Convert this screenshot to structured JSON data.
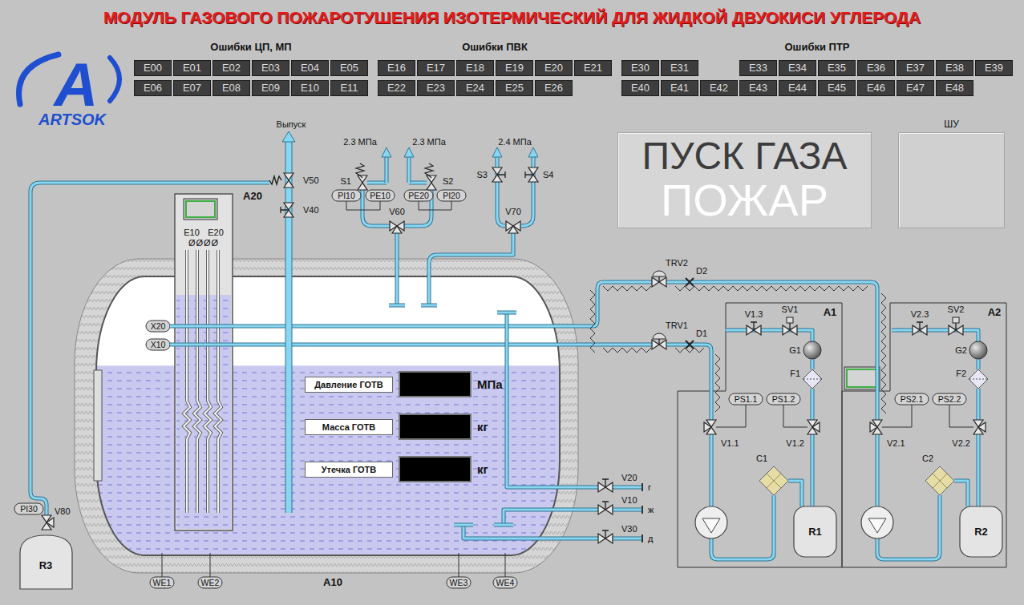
{
  "title": "МОДУЛЬ ГАЗОВОГО ПОЖАРОТУШЕНИЯ ИЗОТЕРМИЧЕСКИЙ ДЛЯ ЖИДКОЙ ДВУОКИСИ УГЛЕРОДА",
  "logo": {
    "letter": "A",
    "name": "ARTSOK"
  },
  "error_groups": [
    {
      "label": "Ошибки ЦП, МП",
      "rows": [
        [
          {
            "kind": "code",
            "code": "E00",
            "active": false
          },
          {
            "kind": "code",
            "code": "E01",
            "active": false
          },
          {
            "kind": "code",
            "code": "E02",
            "active": false
          },
          {
            "kind": "code",
            "code": "E03",
            "active": false
          },
          {
            "kind": "code",
            "code": "E04",
            "active": false
          },
          {
            "kind": "code",
            "code": "E05",
            "active": false
          }
        ],
        [
          {
            "kind": "code",
            "code": "E06",
            "active": false
          },
          {
            "kind": "code",
            "code": "E07",
            "active": false
          },
          {
            "kind": "code",
            "code": "E08",
            "active": false
          },
          {
            "kind": "code",
            "code": "E09",
            "active": false
          },
          {
            "kind": "code",
            "code": "E10",
            "active": false
          },
          {
            "kind": "code",
            "code": "E11",
            "active": false
          }
        ]
      ]
    },
    {
      "label": "Ошибки ПВК",
      "rows": [
        [
          {
            "kind": "code",
            "code": "E16",
            "active": false
          },
          {
            "kind": "code",
            "code": "E17",
            "active": false
          },
          {
            "kind": "code",
            "code": "E18",
            "active": false
          },
          {
            "kind": "code",
            "code": "E19",
            "active": false
          },
          {
            "kind": "code",
            "code": "E20",
            "active": false
          },
          {
            "kind": "code",
            "code": "E21",
            "active": false
          }
        ],
        [
          {
            "kind": "code",
            "code": "E22",
            "active": false
          },
          {
            "kind": "code",
            "code": "E23",
            "active": false
          },
          {
            "kind": "code",
            "code": "E24",
            "active": false
          },
          {
            "kind": "code",
            "code": "E25",
            "active": false
          },
          {
            "kind": "code",
            "code": "E26",
            "active": false
          }
        ]
      ]
    },
    {
      "label": "Ошибки ПТР",
      "rows": [
        [
          {
            "kind": "code",
            "code": "E30",
            "active": false
          },
          {
            "kind": "code",
            "code": "E31",
            "active": false
          },
          {
            "kind": "gap"
          },
          {
            "kind": "code",
            "code": "E33",
            "active": false
          },
          {
            "kind": "code",
            "code": "E34",
            "active": false
          },
          {
            "kind": "code",
            "code": "E35",
            "active": false
          },
          {
            "kind": "code",
            "code": "E36",
            "active": false
          },
          {
            "kind": "code",
            "code": "E37",
            "active": false
          },
          {
            "kind": "code",
            "code": "E38",
            "active": false
          },
          {
            "kind": "code",
            "code": "E39",
            "active": false
          }
        ],
        [
          {
            "kind": "code",
            "code": "E40",
            "active": false
          },
          {
            "kind": "code",
            "code": "E41",
            "active": false
          },
          {
            "kind": "code",
            "code": "E42",
            "active": false
          },
          {
            "kind": "code",
            "code": "E43",
            "active": false
          },
          {
            "kind": "code",
            "code": "E44",
            "active": false
          },
          {
            "kind": "code",
            "code": "E45",
            "active": false
          },
          {
            "kind": "code",
            "code": "E46",
            "active": false
          },
          {
            "kind": "code",
            "code": "E47",
            "active": false
          },
          {
            "kind": "code",
            "code": "E48",
            "active": false
          }
        ]
      ]
    }
  ],
  "outlet": {
    "label": "Выпуск",
    "pipe": "A20"
  },
  "tank": {
    "name": "A10",
    "level": 0.68,
    "lines": [
      "X20",
      "X10"
    ],
    "readouts": [
      {
        "label": "Давление ГОТВ",
        "unit": "МПа"
      },
      {
        "label": "Масса ГОТВ",
        "unit": "кг"
      },
      {
        "label": "Утечка ГОТВ",
        "unit": "кг"
      }
    ]
  },
  "heater": {
    "elements": [
      "E10",
      "E20"
    ],
    "terminals": "ØØØØ"
  },
  "setpoints": [
    "2.3 МПа",
    "2.3 МПа",
    "2.4 МПа"
  ],
  "valves": [
    {
      "tag": "V50",
      "kind": "relief"
    },
    {
      "tag": "V40",
      "kind": "gate"
    },
    {
      "tag": "V80",
      "kind": "three-way"
    },
    {
      "tag": "S1",
      "kind": "safety"
    },
    {
      "tag": "S2",
      "kind": "safety"
    },
    {
      "tag": "V60",
      "kind": "three-way"
    },
    {
      "tag": "S3",
      "kind": "gate"
    },
    {
      "tag": "S4",
      "kind": "gate"
    },
    {
      "tag": "V70",
      "kind": "three-way"
    },
    {
      "tag": "V20",
      "kind": "gate"
    },
    {
      "tag": "V10",
      "kind": "gate"
    },
    {
      "tag": "V30",
      "kind": "gate"
    },
    {
      "tag": "TRV2",
      "kind": "regulator"
    },
    {
      "tag": "TRV1",
      "kind": "regulator"
    },
    {
      "tag": "V1.3",
      "kind": "gate"
    },
    {
      "tag": "SV1",
      "kind": "solenoid"
    },
    {
      "tag": "V1.1",
      "kind": "three-way"
    },
    {
      "tag": "V1.2",
      "kind": "three-way"
    },
    {
      "tag": "V2.3",
      "kind": "gate"
    },
    {
      "tag": "SV2",
      "kind": "solenoid"
    },
    {
      "tag": "V2.1",
      "kind": "three-way"
    },
    {
      "tag": "V2.2",
      "kind": "three-way"
    }
  ],
  "instruments": [
    "PI10",
    "PE10",
    "PE20",
    "PI20",
    "PI30",
    "PS1.1",
    "PS1.2",
    "PS2.1",
    "PS2.2",
    "WE1",
    "WE2",
    "WE3",
    "WE4"
  ],
  "drains": [
    "г",
    "ж",
    "д"
  ],
  "orifices": [
    "D2",
    "D1"
  ],
  "equipment": [
    {
      "tag": "G1",
      "kind": "bottle"
    },
    {
      "tag": "F1",
      "kind": "filter"
    },
    {
      "tag": "C1",
      "kind": "cooler"
    },
    {
      "tag": "R1",
      "kind": "receiver"
    },
    {
      "tag": "G2",
      "kind": "bottle"
    },
    {
      "tag": "F2",
      "kind": "filter"
    },
    {
      "tag": "C2",
      "kind": "cooler"
    },
    {
      "tag": "R2",
      "kind": "receiver"
    },
    {
      "tag": "R3",
      "kind": "tank"
    }
  ],
  "modules": [
    "A1",
    "A2"
  ],
  "launch_panel": [
    {
      "text": "ПУСК ГАЗА",
      "lit": false
    },
    {
      "text": "ПОЖАР",
      "lit": true
    }
  ],
  "cabinet": {
    "label": "ШУ"
  }
}
